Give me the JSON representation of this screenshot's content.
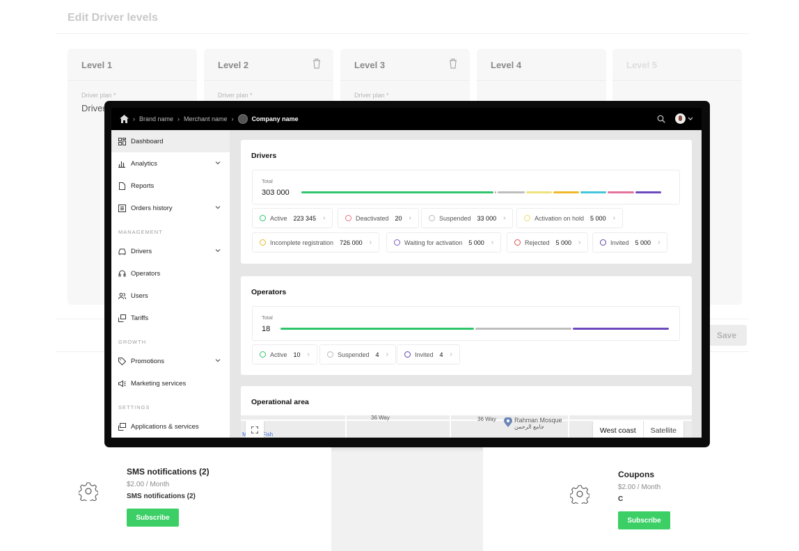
{
  "background": {
    "title": "Edit Driver levels",
    "levels": [
      {
        "label": "Level 1",
        "plan_label": "Driver plan *",
        "plan_value": "Driver"
      },
      {
        "label": "Level 2",
        "plan_label": "Driver plan *"
      },
      {
        "label": "Level 3",
        "plan_label": "Driver plan *"
      },
      {
        "label": "Level 4"
      },
      {
        "label": "Level 5"
      }
    ],
    "save_label": "Save",
    "services": [
      {
        "name": "SMS notifications (2)",
        "price": "$2.00 / Month",
        "desc": "SMS notifications (2)",
        "button": "Subscribe"
      },
      {
        "name": "Coupons",
        "price": "$2.00 / Month",
        "desc": "C",
        "button": "Subscribe"
      }
    ]
  },
  "topbar": {
    "crumbs": [
      "Brand name",
      "Merchant name"
    ],
    "company": "Company name"
  },
  "sidebar": {
    "items": [
      {
        "label": "Dashboard",
        "icon": "dashboard-icon"
      },
      {
        "label": "Analytics",
        "icon": "analytics-icon"
      },
      {
        "label": "Reports",
        "icon": "reports-icon"
      },
      {
        "label": "Orders history",
        "icon": "orders-icon"
      }
    ],
    "management_label": "MANAGEMENT",
    "management": [
      {
        "label": "Drivers",
        "icon": "car-icon"
      },
      {
        "label": "Operators",
        "icon": "headset-icon"
      },
      {
        "label": "Users",
        "icon": "users-icon"
      },
      {
        "label": "Tariffs",
        "icon": "tariffs-icon"
      }
    ],
    "growth_label": "GROWTH",
    "growth": [
      {
        "label": "Promotions",
        "icon": "tag-icon"
      },
      {
        "label": "Marketing services",
        "icon": "megaphone-icon"
      }
    ],
    "settings_label": "SETTINGS",
    "settings": [
      {
        "label": "Applications & services",
        "icon": "apps-icon"
      }
    ]
  },
  "drivers": {
    "title": "Drivers",
    "total_label": "Total",
    "total": "303 000",
    "statuses": [
      {
        "label": "Active",
        "value": "223 345",
        "color": "#2ec56a"
      },
      {
        "label": "Deactivated",
        "value": "20",
        "color": "#e9717f"
      },
      {
        "label": "Suspended",
        "value": "33 000",
        "color": "#b8b8b8"
      },
      {
        "label": "Activation on hold",
        "value": "5 000",
        "color": "#eddc6a"
      },
      {
        "label": "Incomplete registration",
        "value": "726 000",
        "color": "#e6b722"
      },
      {
        "label": "Waiting for activation",
        "value": "5 000",
        "color": "#7b55c7"
      },
      {
        "label": "Rejected",
        "value": "5 000",
        "color": "#d9534f"
      },
      {
        "label": "Invited",
        "value": "5 000",
        "color": "#5b3fa8"
      }
    ],
    "bar_segments": [
      {
        "color": "#2ec56a",
        "share": 0.525
      },
      {
        "color": "#e98fb0",
        "share": 0.008
      },
      {
        "color": "#bdbdbd",
        "share": 0.076
      },
      {
        "color": "#efe27a",
        "share": 0.074
      },
      {
        "color": "#f0b92b",
        "share": 0.074
      },
      {
        "color": "#43c6da",
        "share": 0.074
      },
      {
        "color": "#e4739b",
        "share": 0.074
      },
      {
        "color": "#6b49bd",
        "share": 0.075
      }
    ]
  },
  "operators": {
    "title": "Operators",
    "total_label": "Total",
    "total": "18",
    "statuses": [
      {
        "label": "Active",
        "value": "10",
        "color": "#2ec56a"
      },
      {
        "label": "Suspended",
        "value": "4",
        "color": "#b8b8b8"
      },
      {
        "label": "Invited",
        "value": "4",
        "color": "#5b3fa8"
      }
    ],
    "bar_segments": [
      {
        "color": "#2ec56a",
        "share": 0.5
      },
      {
        "color": "#bdbdbd",
        "share": 0.25
      },
      {
        "color": "#6b49bd",
        "share": 0.25
      }
    ]
  },
  "operational_area": {
    "title": "Operational area",
    "map_labels": [
      "36 Way",
      "36 Way",
      "Rahman Mosque",
      "جامع الرحمن",
      "Maritan Fish"
    ],
    "view_options": [
      "West coast",
      "Satellite"
    ]
  }
}
